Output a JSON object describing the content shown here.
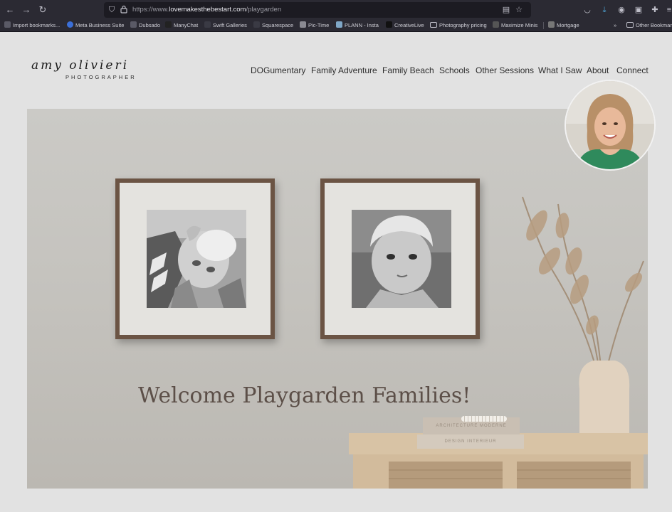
{
  "browser": {
    "url_prefix": "https://www.",
    "url_host": "lovemakesthebestart.com",
    "url_path": "/playgarden",
    "bookmarks": [
      "Import bookmarks...",
      "Meta Business Suite",
      "Dubsado",
      "ManyChat",
      "Swift Galleries",
      "Squarespace",
      "Pic-Time",
      "PLANN - Insta",
      "CreativeLive",
      "Photography pricing",
      "Maximize Minis",
      "Mortgage"
    ],
    "overflow_label": "»",
    "other_bookmarks": "Other Bookmarks"
  },
  "site": {
    "logo_script": "amy olivieri",
    "logo_sub": "PHOTOGRAPHER",
    "nav": [
      "DOGumentary",
      "Family Adventure",
      "Family Beach",
      "Schools",
      "Other Sessions",
      "What I Saw",
      "About",
      "Connect"
    ],
    "hero_title": "Welcome Playgarden Families!",
    "book_titles": [
      "ARCHITECTURE MODERNE",
      "DESIGN INTERIEUR"
    ]
  },
  "colors": {
    "nav_text": "#2e2e2e",
    "headline": "#5c4f48",
    "frame": "#6b5444"
  }
}
